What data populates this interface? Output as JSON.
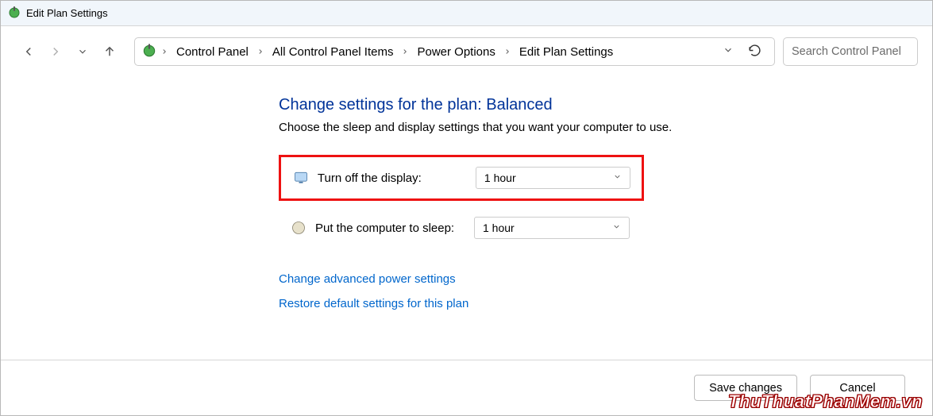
{
  "window": {
    "title": "Edit Plan Settings"
  },
  "breadcrumb": {
    "items": [
      "Control Panel",
      "All Control Panel Items",
      "Power Options",
      "Edit Plan Settings"
    ]
  },
  "search": {
    "placeholder": "Search Control Panel"
  },
  "page": {
    "heading": "Change settings for the plan: Balanced",
    "subtext": "Choose the sleep and display settings that you want your computer to use."
  },
  "settings": {
    "display": {
      "label": "Turn off the display:",
      "value": "1 hour"
    },
    "sleep": {
      "label": "Put the computer to sleep:",
      "value": "1 hour"
    }
  },
  "links": {
    "advanced": "Change advanced power settings",
    "restore": "Restore default settings for this plan"
  },
  "footer": {
    "save": "Save changes",
    "cancel": "Cancel"
  },
  "watermark": "ThuThuatPhanMem.vn"
}
